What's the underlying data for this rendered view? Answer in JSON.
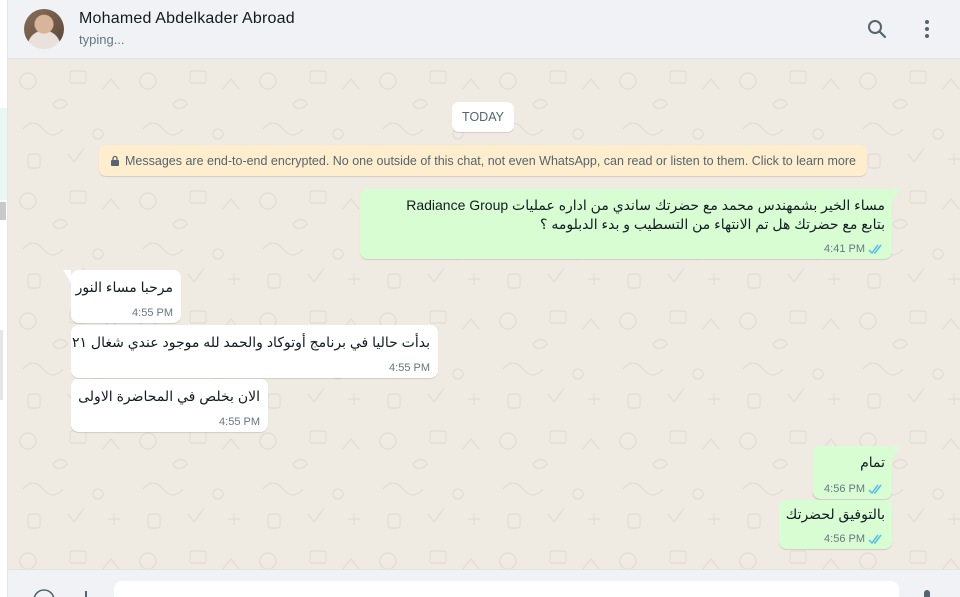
{
  "header": {
    "contact_name": "Mohamed Abdelkader Abroad",
    "status": "typing...",
    "icons": [
      "search-icon",
      "menu-icon"
    ]
  },
  "chat": {
    "date_chip": "TODAY",
    "encryption_notice": "Messages are end-to-end encrypted. No one outside of this chat, not even WhatsApp, can read or listen to them. Click to learn more",
    "messages": [
      {
        "direction": "out",
        "lines": [
          "مساء الخير بشمهندس محمد مع حضرتك ساندي من اداره عمليات Radiance Group",
          "بتابع مع حضرتك هل تم الانتهاء من التسطيب و بدء الدبلومه ؟"
        ],
        "time": "4:41 PM",
        "status": "read"
      },
      {
        "direction": "in",
        "lines": [
          "مرحبا مساء النور"
        ],
        "time": "4:55 PM"
      },
      {
        "direction": "in",
        "lines": [
          "بدأت حاليا في برنامج أوتوكاد والحمد لله موجود عندي شغال ٢١"
        ],
        "time": "4:55 PM"
      },
      {
        "direction": "in",
        "lines": [
          "الان بخلص في المحاضرة الاولى"
        ],
        "time": "4:55 PM"
      },
      {
        "direction": "out",
        "lines": [
          "تمام"
        ],
        "time": "4:56 PM",
        "status": "read"
      },
      {
        "direction": "out",
        "lines": [
          "بالتوفيق لحضرتك"
        ],
        "time": "4:56 PM",
        "status": "read"
      }
    ]
  },
  "colors": {
    "outgoing_bubble": "#d9fdd3",
    "incoming_bubble": "#ffffff",
    "chat_background": "#efeae2",
    "read_ticks": "#53bdeb",
    "notice_background": "#ffeecd"
  }
}
